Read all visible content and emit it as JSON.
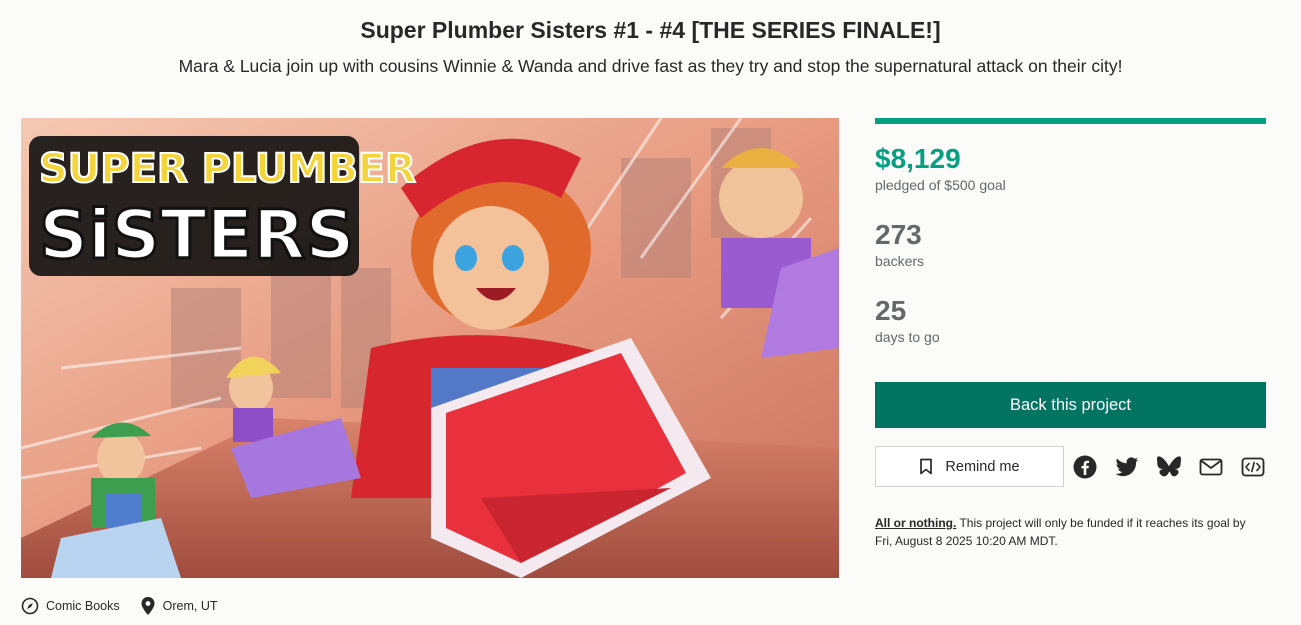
{
  "project": {
    "title": "Super Plumber Sisters #1 - #4 [THE SERIES FINALE!]",
    "blurb": "Mara & Lucia join up with cousins Winnie & Wanda and drive fast as they try and stop the supernatural attack on their city!"
  },
  "hero": {
    "logo_line1": "SUPER PLUMBER",
    "logo_line2": "SiSTERS"
  },
  "meta": {
    "category": "Comic Books",
    "category_icon": "compass-icon",
    "location": "Orem, UT",
    "location_icon": "map-pin-icon"
  },
  "funding": {
    "pledged": "$8,129",
    "pledged_label": "pledged of $500 goal",
    "progress_fraction": 1.0,
    "backers": "273",
    "backers_label": "backers",
    "days": "25",
    "days_label": "days to go"
  },
  "actions": {
    "back_label": "Back this project",
    "remind_label": "Remind me",
    "share_icons": [
      "facebook-icon",
      "twitter-icon",
      "bluesky-icon",
      "email-icon",
      "embed-icon"
    ]
  },
  "notice": {
    "link_text": "All or nothing.",
    "text": " This project will only be funded if it reaches its goal by Fri, August 8 2025 10:20 AM MDT."
  },
  "colors": {
    "accent": "#05a081",
    "button": "#037362",
    "muted": "#656969"
  }
}
